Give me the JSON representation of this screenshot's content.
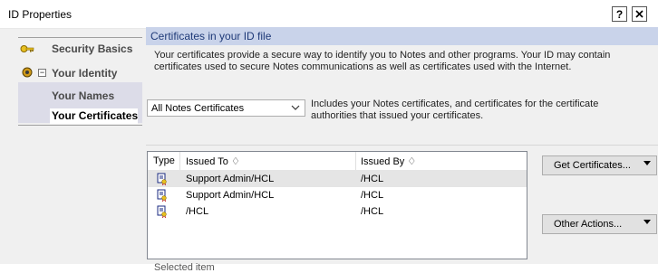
{
  "window": {
    "title": "ID Properties",
    "help_label": "?",
    "close_label": "X"
  },
  "sidebar": {
    "items": [
      {
        "label": "Security Basics"
      },
      {
        "label": "Your Identity"
      },
      {
        "label": "Your Names"
      },
      {
        "label": "Your Certificates"
      }
    ],
    "expander": "−"
  },
  "main": {
    "header": "Certificates in your ID file",
    "description": "Your certificates provide a secure way to identify you to Notes and other programs. Your ID may contain certificates used to secure Notes communications as well as certificates used with the Internet.",
    "filter": {
      "selected": "All Notes Certificates",
      "description": "Includes your Notes certificates, and certificates for the certificate authorities that issued your certificates."
    },
    "table": {
      "columns": [
        "Type",
        "Issued To ♢",
        "Issued By ♢"
      ],
      "rows": [
        {
          "issued_to": "Support Admin/HCL",
          "issued_by": "/HCL",
          "selected": true
        },
        {
          "issued_to": "Support Admin/HCL",
          "issued_by": "/HCL",
          "selected": false
        },
        {
          "issued_to": "/HCL",
          "issued_by": "/HCL",
          "selected": false
        }
      ]
    },
    "buttons": {
      "get_certificates": "Get Certificates...",
      "other_actions": "Other Actions..."
    },
    "selected_item_label": "Selected item"
  }
}
